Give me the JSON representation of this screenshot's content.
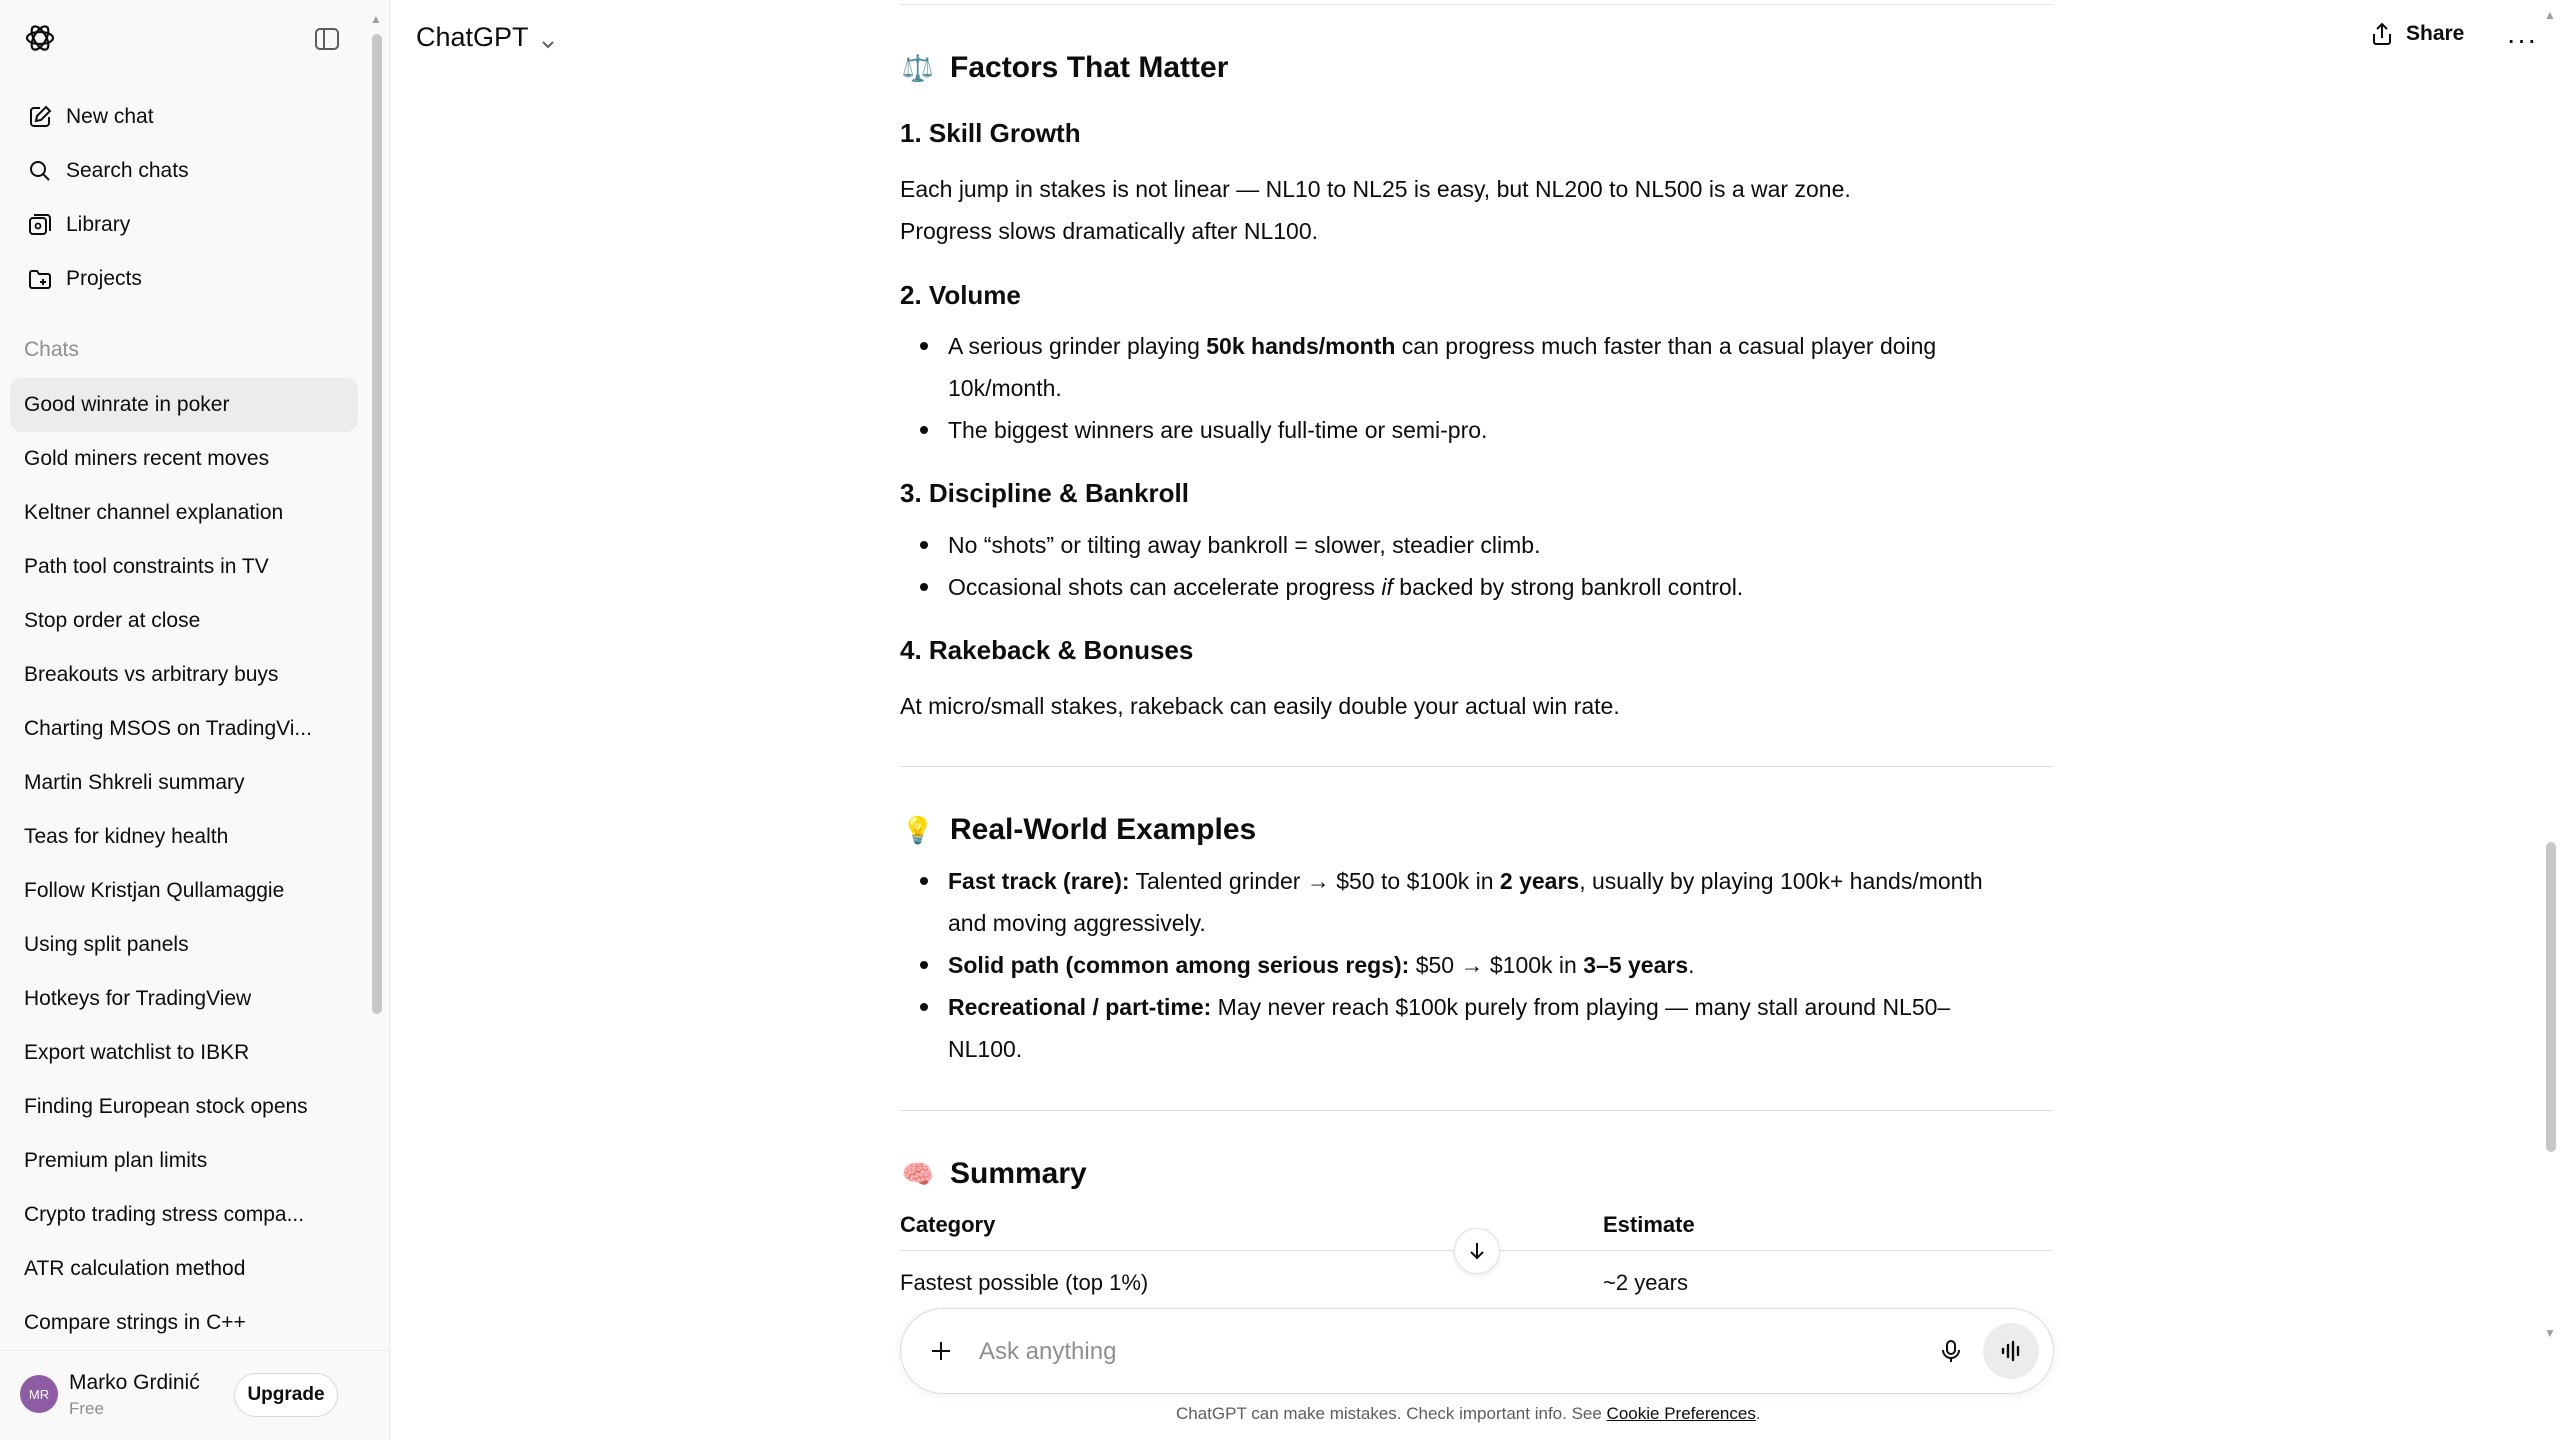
{
  "sidebar": {
    "nav": [
      {
        "label": "New chat",
        "icon": "new-chat-icon"
      },
      {
        "label": "Search chats",
        "icon": "search-icon"
      },
      {
        "label": "Library",
        "icon": "library-icon"
      },
      {
        "label": "Projects",
        "icon": "projects-icon"
      }
    ],
    "chats_heading": "Chats",
    "chats": [
      "Good winrate in poker",
      "Gold miners recent moves",
      "Keltner channel explanation",
      "Path tool constraints in TV",
      "Stop order at close",
      "Breakouts vs arbitrary buys",
      "Charting MSOS on TradingVi...",
      "Martin Shkreli summary",
      "Teas for kidney health",
      "Follow Kristjan Qullamaggie",
      "Using split panels",
      "Hotkeys for TradingView",
      "Export watchlist to IBKR",
      "Finding European stock opens",
      "Premium plan limits",
      "Crypto trading stress compa...",
      "ATR calculation method",
      "Compare strings in C++"
    ],
    "active_chat_index": 0,
    "user": {
      "initials": "MR",
      "name": "Marko Grdinić",
      "plan": "Free"
    },
    "upgrade_label": "Upgrade"
  },
  "header": {
    "model": "ChatGPT",
    "share_label": "Share"
  },
  "content": {
    "factors": {
      "emoji": "⚖️",
      "title": "Factors That Matter",
      "skill": {
        "title": "1. Skill Growth",
        "line1": "Each jump in stakes is not linear — NL10 to NL25 is easy, but NL200 to NL500 is a war zone.",
        "line2": "Progress slows dramatically after NL100."
      },
      "volume": {
        "title": "2. Volume",
        "b1_pre": "A serious grinder playing ",
        "b1_bold": "50k hands/month",
        "b1_post": " can progress much faster than a casual player doing",
        "b1_cont": "10k/month.",
        "b2": "The biggest winners are usually full-time or semi-pro."
      },
      "discipline": {
        "title": "3. Discipline & Bankroll",
        "b1": "No “shots” or tilting away bankroll = slower, steadier climb.",
        "b2_pre": "Occasional shots can accelerate progress ",
        "b2_ital": "if",
        "b2_post": " backed by strong bankroll control."
      },
      "rakeback": {
        "title": "4. Rakeback & Bonuses",
        "text": "At micro/small stakes, rakeback can easily double your actual win rate."
      }
    },
    "examples": {
      "emoji": "💡",
      "title": "Real-World Examples",
      "fast_label": "Fast track (rare):",
      "fast_pre": " Talented grinder → $50 to $100k in ",
      "fast_bold": "2 years",
      "fast_post": ", usually by playing 100k+ hands/month",
      "fast_cont": "and moving aggressively.",
      "solid_label": "Solid path (common among serious regs):",
      "solid_pre": " $50 → $100k in ",
      "solid_bold": "3–5 years",
      "solid_post": ".",
      "rec_label": "Recreational / part-time:",
      "rec_text": " May never reach $100k purely from playing — many stall around NL50–",
      "rec_cont": "NL100."
    },
    "summary": {
      "emoji": "🧠",
      "title": "Summary",
      "columns": [
        "Category",
        "Estimate"
      ],
      "rows": [
        [
          "Fastest possible (top 1%)",
          "~2 years"
        ]
      ]
    }
  },
  "composer": {
    "placeholder": "Ask anything"
  },
  "footer": {
    "disclaimer": "ChatGPT can make mistakes. Check important info. See ",
    "link": "Cookie Preferences",
    "end": "."
  }
}
